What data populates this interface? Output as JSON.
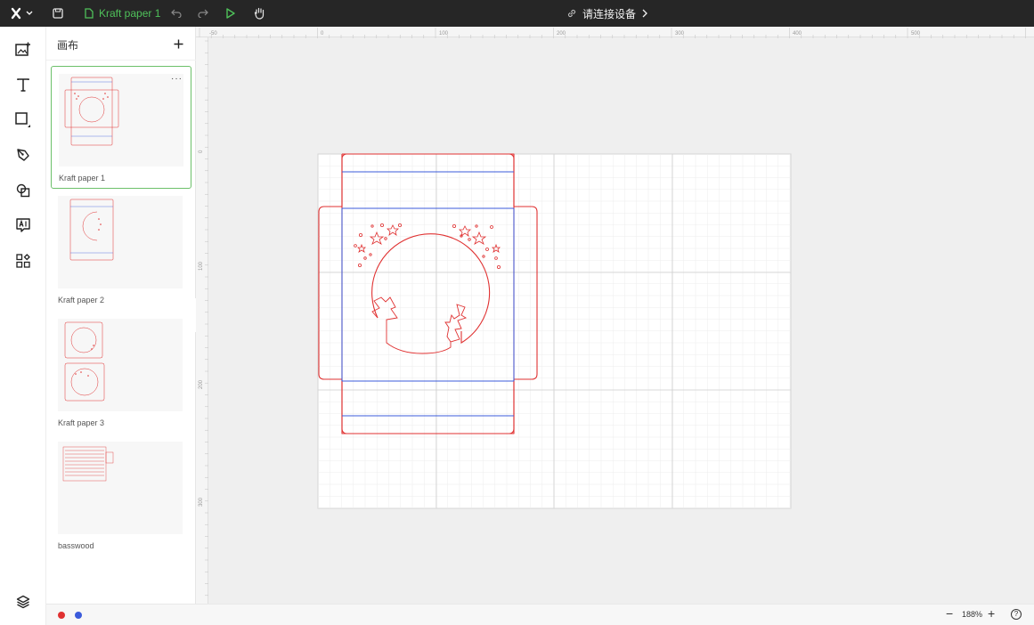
{
  "topbar": {
    "doc_title": "Kraft paper 1",
    "connect_label": "请连接设备"
  },
  "panel": {
    "title": "画布",
    "cards": [
      {
        "label": "Kraft paper 1",
        "active": true,
        "more": "···"
      },
      {
        "label": "Kraft paper 2",
        "active": false
      },
      {
        "label": "Kraft paper 3",
        "active": false
      },
      {
        "label": "basswood",
        "active": false
      }
    ]
  },
  "rulers": {
    "top_labels": [
      "-50",
      "0",
      "100",
      "200",
      "300",
      "400",
      "500"
    ],
    "left_labels": [
      "0",
      "100",
      "200",
      "300"
    ]
  },
  "statusbar": {
    "zoom": "188%",
    "layer_colors": [
      "#e03131",
      "#3b5bdb"
    ]
  },
  "colors": {
    "accent": "#4fc15a",
    "cut_line": "#e03131",
    "score_line": "#3b5bdb"
  }
}
